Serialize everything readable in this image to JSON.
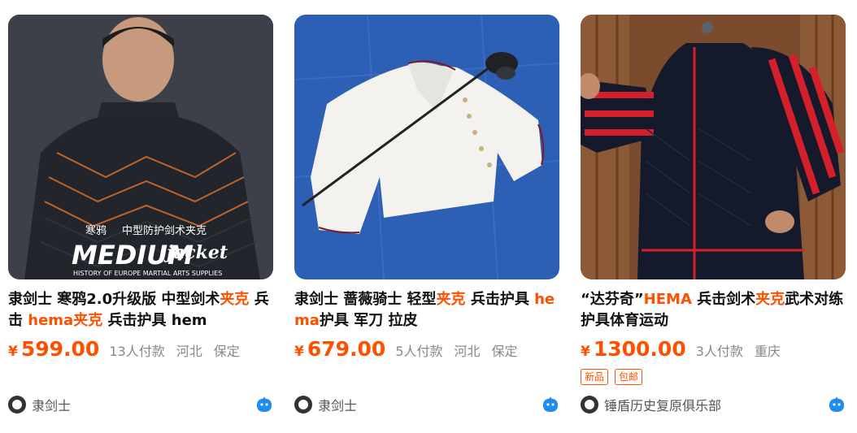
{
  "products": [
    {
      "title_parts": [
        {
          "text": "隶剑士 寒鸦2.0升级版 中型剑术",
          "hl": false
        },
        {
          "text": "夹克",
          "hl": true
        },
        {
          "text": " 兵击 ",
          "hl": false
        },
        {
          "text": "hema夹克",
          "hl": true
        },
        {
          "text": " 兵击护具 hem",
          "hl": false
        }
      ],
      "currency": "¥",
      "price": "599.00",
      "sales": "13人付款",
      "location": [
        "河北",
        "保定"
      ],
      "tags": [],
      "shop_name": "隶剑士",
      "image": {
        "lines": [
          "寒鸦",
          "中型防护剑术夹克"
        ],
        "big": "MEDIUM",
        "script": "jacket",
        "small": "HISTORY OF EUROPE MARTIAL ARTS SUPPLIES"
      }
    },
    {
      "title_parts": [
        {
          "text": "隶剑士 蔷薇骑士 轻型",
          "hl": false
        },
        {
          "text": "夹克",
          "hl": true
        },
        {
          "text": " 兵击护具 ",
          "hl": false
        },
        {
          "text": "hema",
          "hl": true
        },
        {
          "text": "护具 军刀 拉皮",
          "hl": false
        }
      ],
      "currency": "¥",
      "price": "679.00",
      "sales": "5人付款",
      "location": [
        "河北",
        "保定"
      ],
      "tags": [],
      "shop_name": "隶剑士"
    },
    {
      "title_parts": [
        {
          "text": "“达芬奇”",
          "hl": false
        },
        {
          "text": "HEMA",
          "hl": true
        },
        {
          "text": " 兵击剑术",
          "hl": false
        },
        {
          "text": "夹克",
          "hl": true
        },
        {
          "text": "武术对练护具体育运动",
          "hl": false
        }
      ],
      "currency": "¥",
      "price": "1300.00",
      "sales": "3人付款",
      "location": [
        "重庆"
      ],
      "tags": [
        "新品",
        "包邮"
      ],
      "shop_name": "锤盾历史复原俱乐部"
    }
  ],
  "colors": {
    "accent": "#ff5000",
    "title": "#111111",
    "meta": "#888888",
    "shop": "#555555",
    "chat_icon": "#1e8cf0"
  },
  "icons": {
    "shop_avatar": "shop-avatar-icon",
    "chat": "wangwang-chat-icon"
  }
}
